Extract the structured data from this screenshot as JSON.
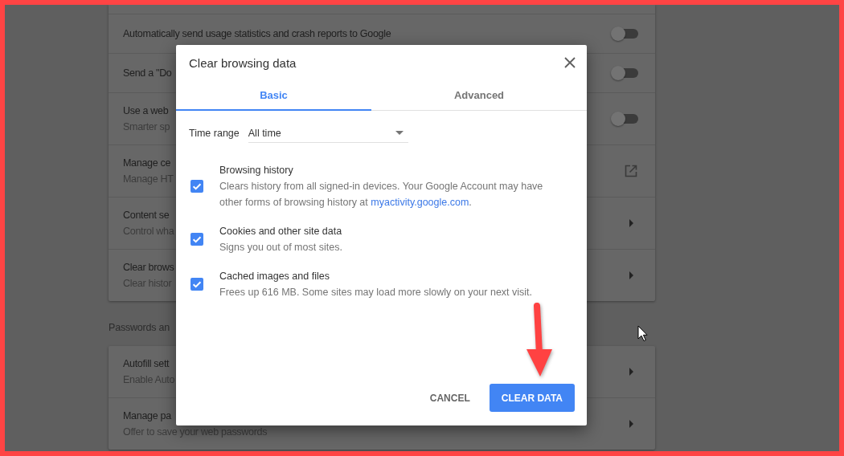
{
  "settings_page": {
    "upper_card": {
      "rows": [
        {
          "kind": "toggle",
          "title": "Automatically send usage statistics and crash reports to Google",
          "on": false
        },
        {
          "kind": "toggle",
          "title": "Send a \"Do",
          "on": false
        },
        {
          "kind": "toggle",
          "title": "Use a web",
          "subtitle": "Smarter sp",
          "on": false
        },
        {
          "kind": "external",
          "title": "Manage ce",
          "subtitle": "Manage HT"
        },
        {
          "kind": "submenu",
          "title": "Content se",
          "subtitle": "Control wha"
        },
        {
          "kind": "submenu",
          "title": "Clear brows",
          "subtitle": "Clear histor"
        }
      ]
    },
    "lower_section": {
      "heading": "Passwords an",
      "rows": [
        {
          "kind": "submenu",
          "title": "Autofill sett",
          "subtitle": "Enable Auto"
        },
        {
          "kind": "submenu",
          "title": "Manage pa",
          "subtitle": "Offer to save your web passwords"
        }
      ]
    }
  },
  "dialog": {
    "title": "Clear browsing data",
    "tabs": [
      {
        "label": "Basic",
        "selected": true
      },
      {
        "label": "Advanced",
        "selected": false
      }
    ],
    "time_range": {
      "label": "Time range",
      "value": "All time"
    },
    "items": [
      {
        "title": "Browsing history",
        "description": "Clears history from all signed-in devices. Your Google Account may have other forms of browsing history at",
        "link": "myactivity.google.com",
        "description_end": ".",
        "checked": true
      },
      {
        "title": "Cookies and other site data",
        "description": "Signs you out of most sites.",
        "checked": true
      },
      {
        "title": "Cached images and files",
        "description": "Frees up 616 MB. Some sites may load more slowly on your next visit.",
        "checked": true
      }
    ],
    "buttons": [
      {
        "label": "CANCEL",
        "kind": "secondary"
      },
      {
        "label": "CLEAR DATA",
        "kind": "primary"
      }
    ]
  }
}
